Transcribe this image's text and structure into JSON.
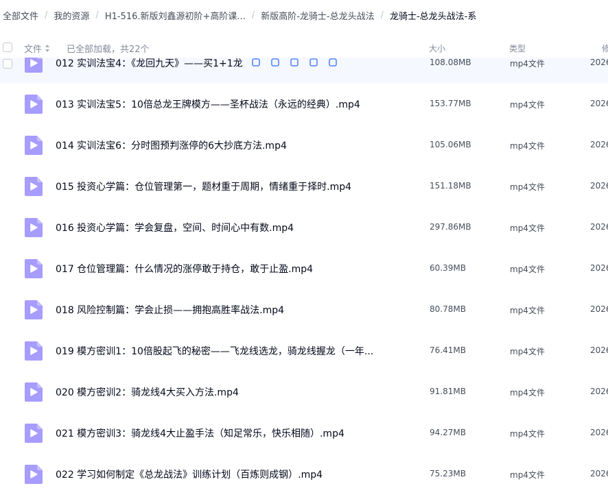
{
  "breadcrumb": {
    "items": [
      "全部文件",
      "我的资源",
      "H1-516.新版刘鑫源初阶+高阶课...",
      "新版高阶-龙骑士-总龙头战法",
      "龙骑士-总龙头战法-系"
    ],
    "separator": "/"
  },
  "header": {
    "name_label": "文件",
    "status": "已全部加载，共22个",
    "size_label": "大小",
    "type_label": "类型",
    "date_label": "修"
  },
  "colors": {
    "file_icon_bg": "#a79cff",
    "file_icon_play": "#ffffff",
    "row_hover": "#f5f8ff"
  },
  "files": [
    {
      "name": "012 实训法宝4：《龙回九天》——买1+1龙",
      "size": "108.08MB",
      "type": "mp4文件",
      "date": "2026",
      "icon": "video-file-icon"
    },
    {
      "name": "013 实训法宝5：10倍总龙王牌模方——圣杯战法（永远的经典）.mp4",
      "size": "153.77MB",
      "type": "mp4文件",
      "date": "2026",
      "icon": "video-file-icon"
    },
    {
      "name": "014 实训法宝6：分时图预判涨停的6大抄底方法.mp4",
      "size": "105.06MB",
      "type": "mp4文件",
      "date": "2026",
      "icon": "video-file-icon"
    },
    {
      "name": "015 投资心学篇：仓位管理第一，题材重于周期，情绪重于择时.mp4",
      "size": "151.18MB",
      "type": "mp4文件",
      "date": "2026",
      "icon": "video-file-icon"
    },
    {
      "name": "016 投资心学篇：学会复盘，空间、时间心中有数.mp4",
      "size": "297.86MB",
      "type": "mp4文件",
      "date": "2026",
      "icon": "video-file-icon"
    },
    {
      "name": "017 仓位管理篇：什么情况的涨停敢于持仓，敢于止盈.mp4",
      "size": "60.39MB",
      "type": "mp4文件",
      "date": "2026",
      "icon": "video-file-icon"
    },
    {
      "name": "018 风险控制篇：学会止损——拥抱高胜率战法.mp4",
      "size": "80.78MB",
      "type": "mp4文件",
      "date": "2026",
      "icon": "video-file-icon"
    },
    {
      "name": "019 模方密训1：10倍股起飞的秘密——飞龙线选龙，骑龙线握龙（一年...",
      "size": "76.41MB",
      "type": "mp4文件",
      "date": "2026",
      "icon": "video-file-icon"
    },
    {
      "name": "020 模方密训2：骑龙线4大买入方法.mp4",
      "size": "91.81MB",
      "type": "mp4文件",
      "date": "2026",
      "icon": "video-file-icon"
    },
    {
      "name": "021 模方密训3：骑龙线4大止盈手法（知足常乐，快乐相随）.mp4",
      "size": "94.27MB",
      "type": "mp4文件",
      "date": "2026",
      "icon": "video-file-icon"
    },
    {
      "name": "022 学习如何制定《总龙战法》训练计划（百炼则成钢）.mp4",
      "size": "75.23MB",
      "type": "mp4文件",
      "date": "2026",
      "icon": "video-file-icon"
    }
  ]
}
